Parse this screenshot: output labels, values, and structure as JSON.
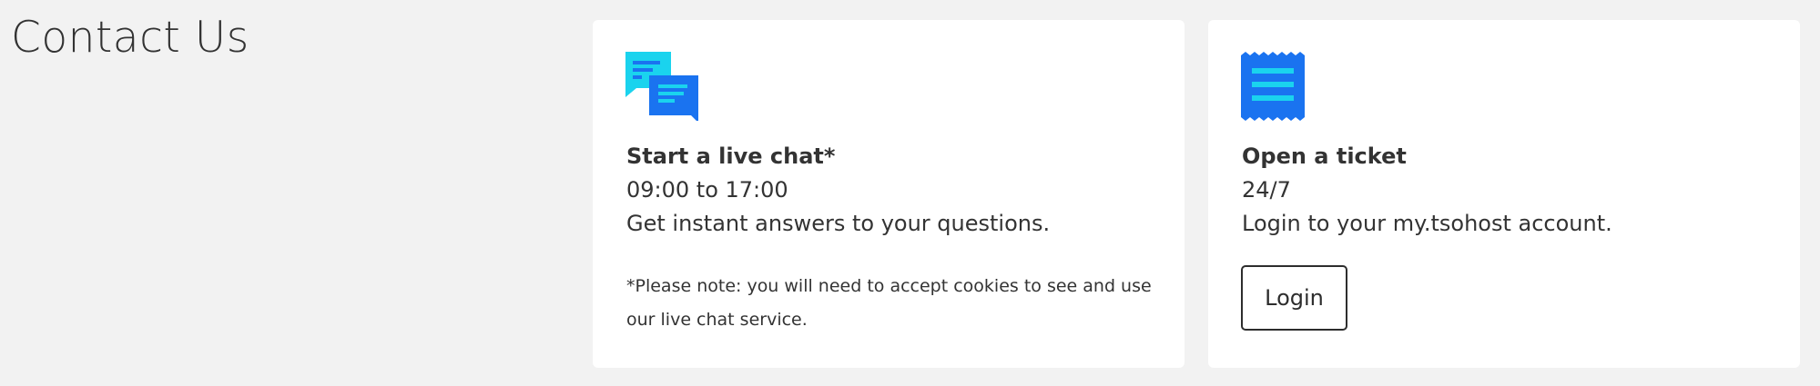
{
  "page": {
    "title": "Contact Us"
  },
  "live_chat": {
    "icon": "chat-bubbles-icon",
    "heading": "Start a live chat*",
    "hours": "09:00 to 17:00",
    "description": "Get instant answers to your questions.",
    "note": "*Please note: you will need to accept cookies to see and use our live chat service."
  },
  "ticket": {
    "icon": "ticket-receipt-icon",
    "heading": "Open a ticket",
    "hours": "24/7",
    "description": "Login to your my.tsohost account.",
    "login_label": "Login"
  },
  "colors": {
    "background": "#f2f2f2",
    "card": "#ffffff",
    "accent_blue": "#1a73f0",
    "accent_cyan": "#1ad3ee",
    "text": "#333333"
  }
}
